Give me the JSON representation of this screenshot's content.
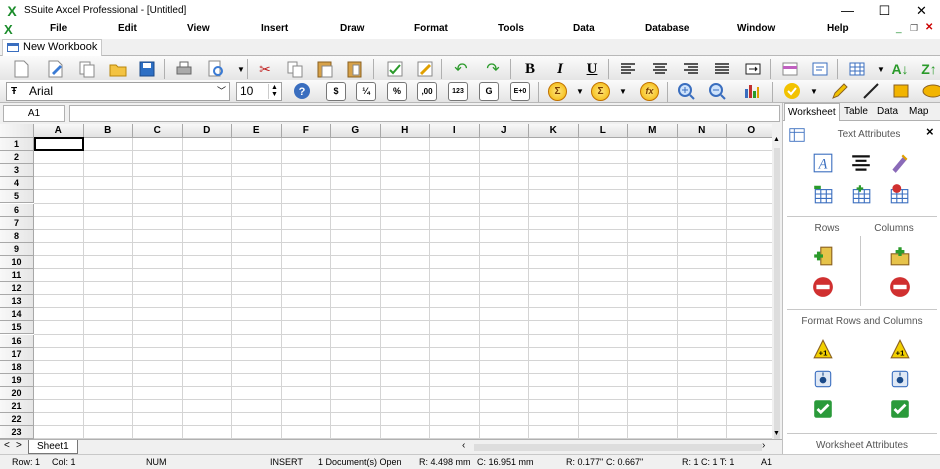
{
  "window": {
    "title": "SSuite Axcel Professional - [Untitled]",
    "minimize": "—",
    "maximize": "☐",
    "close": "✕"
  },
  "menu": {
    "file": "File",
    "edit": "Edit",
    "view": "View",
    "insert": "Insert",
    "draw": "Draw",
    "format": "Format",
    "tools": "Tools",
    "data": "Data",
    "database": "Database",
    "window": "Window",
    "help": "Help"
  },
  "doc_tab": "New Workbook",
  "format_bar": {
    "font": "Arial",
    "font_size": "10",
    "bold": "B",
    "italic": "I",
    "underline": "U",
    "currency": "$",
    "fraction": "¼",
    "percent": "%",
    "decimal": ",00",
    "number": "123",
    "general": "G",
    "scientific": "E+0"
  },
  "formula_bar": {
    "cell_ref": "A1",
    "formula": ""
  },
  "grid": {
    "columns": [
      "A",
      "B",
      "C",
      "D",
      "E",
      "F",
      "G",
      "H",
      "I",
      "J",
      "K",
      "L",
      "M",
      "N",
      "O"
    ],
    "rows": [
      "1",
      "2",
      "3",
      "4",
      "5",
      "6",
      "7",
      "8",
      "9",
      "10",
      "11",
      "12",
      "13",
      "14",
      "15",
      "16",
      "17",
      "18",
      "19",
      "20",
      "21",
      "22",
      "23"
    ]
  },
  "sheet_tab": "Sheet1",
  "status": {
    "row": "Row:  1",
    "col": "Col:  1",
    "num": "NUM",
    "insert": "INSERT",
    "docs": "1 Document(s) Open",
    "r_mm": "R: 4.498 mm",
    "c_mm": "C: 16.951 mm",
    "r_in": "R: 0.177\"",
    "c_in": "C: 0.667\"",
    "rct": "R: 1  C: 1  T: 1",
    "cell": "A1"
  },
  "panel": {
    "tabs": [
      "Worksheet",
      "Table",
      "Data",
      "Map"
    ],
    "text_attributes": "Text Attributes",
    "rows": "Rows",
    "columns": "Columns",
    "format_rows_columns": "Format Rows and Columns",
    "worksheet_attributes": "Worksheet Attributes",
    "close": "×"
  }
}
